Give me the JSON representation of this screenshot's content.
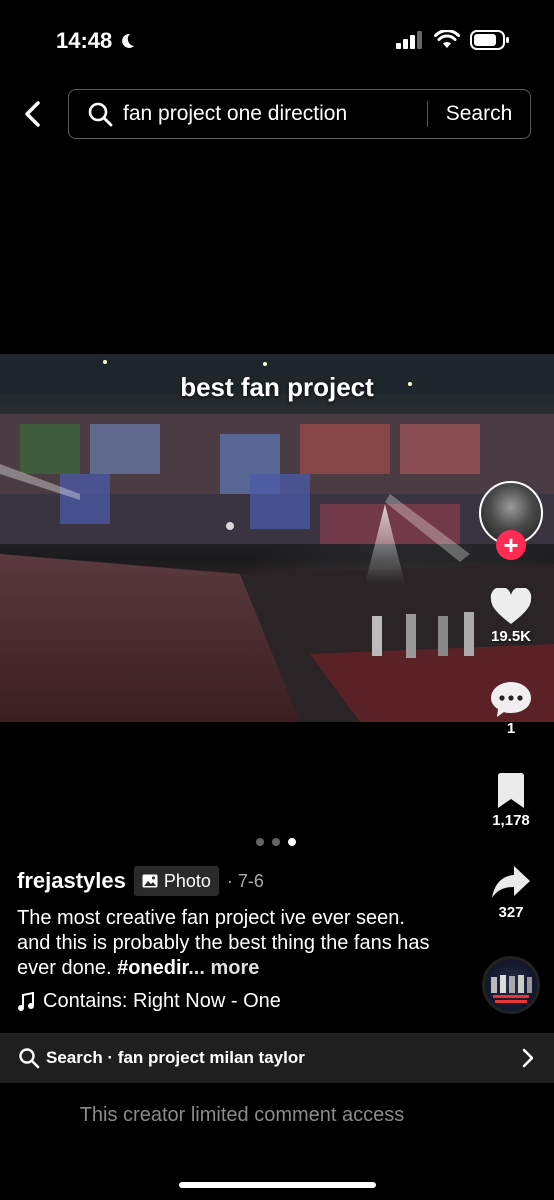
{
  "status_bar": {
    "time": "14:48"
  },
  "search": {
    "query": "fan project one direction",
    "submit_label": "Search"
  },
  "post": {
    "caption_overlay": "best fan project",
    "username": "frejastyles",
    "badge_label": "Photo",
    "date": "· 7-6",
    "description": "The most creative fan project ive ever seen. and this is probably the best thing the fans has ever done. ",
    "hashtag": "#onedir",
    "ellipsis": "...",
    "more_label": "more",
    "sound": "Contains: Right Now - One",
    "photo_index": 3,
    "photo_count": 3
  },
  "actions": {
    "likes": "19.5K",
    "comments": "1",
    "saves": "1,178",
    "shares": "327"
  },
  "related_search": {
    "text": "Search · fan project milan taylor"
  },
  "comment_notice": "This creator limited comment access",
  "icons": [
    "moon-icon",
    "signal-icon",
    "wifi-icon",
    "battery-icon",
    "back-chevron-icon",
    "search-icon",
    "heart-icon",
    "comment-icon",
    "bookmark-icon",
    "share-icon",
    "music-note-icon",
    "photo-icon",
    "chevron-right-icon"
  ],
  "colors": {
    "background": "#000000",
    "accent_follow": "#fe2c55",
    "related_bar": "#1f1f1f",
    "muted_text": "#8a8a8a"
  }
}
